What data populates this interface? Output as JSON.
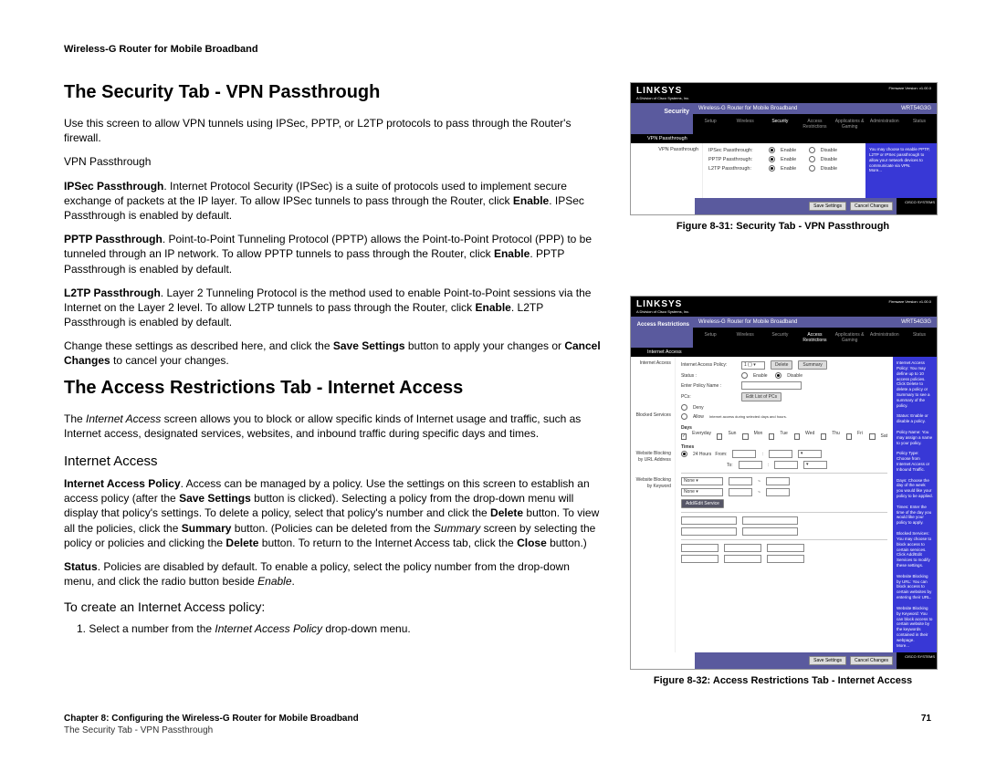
{
  "header": "Wireless-G Router for Mobile Broadband",
  "h1a": "The Security Tab - VPN Passthrough",
  "p1": "Use this screen to allow VPN tunnels using IPSec, PPTP, or L2TP protocols to pass through the Router's firewall.",
  "p2": "VPN Passthrough",
  "p3": "<b>IPSec Passthrough</b>. Internet Protocol Security (IPSec) is a suite of protocols used to implement secure exchange of packets at the IP layer. To allow IPSec tunnels to pass through the Router, click <b>Enable</b>. IPSec Passthrough is enabled by default.",
  "p4": "<b>PPTP Passthrough</b>. Point-to-Point Tunneling Protocol (PPTP) allows the Point-to-Point Protocol (PPP) to be tunneled through an IP network. To allow PPTP tunnels to pass through the Router, click <b>Enable</b>. PPTP Passthrough is enabled by default.",
  "p5": "<b>L2TP Passthrough</b>. Layer 2 Tunneling Protocol is the method used to enable Point-to-Point sessions via the Internet on the Layer 2 level. To allow L2TP tunnels to pass through the Router, click <b>Enable</b>. L2TP Passthrough is enabled by default.",
  "p6": "Change these settings as described here, and click the <b>Save Settings</b> button to apply your changes or <b>Cancel Changes</b> to cancel your changes.",
  "h1b": "The Access Restrictions Tab - Internet Access",
  "p7": "The <i>Internet Access</i> screen allows you to block or allow specific kinds of Internet usage and traffic, such as Internet access, designated services, websites, and inbound traffic during specific days and times.",
  "h2a": "Internet Access",
  "p8": "<b>Internet Access Policy</b>. Access can be managed by a policy. Use the settings on this screen to establish an access policy (after the <b>Save Settings</b> button is clicked). Selecting a policy from the drop-down menu will display that policy's settings. To delete a policy, select that policy's number and click the <b>Delete</b> button. To view all the policies, click the <b>Summary</b> button. (Policies can be deleted from the <i>Summary</i> screen by selecting the policy or policies and clicking the <b>Delete</b> button. To return to the Internet Access tab, click the <b>Close</b> button.)",
  "p9": "<b>Status</b>. Policies are disabled by default. To enable a policy, select the policy number from the drop-down menu, and click the radio button beside <i>Enable</i>.",
  "h3a": "To create an Internet Access policy:",
  "li1": "1.   Select a number from the <i>Internet Access Policy</i> drop-down menu.",
  "caption1": "Figure 8-31: Security Tab - VPN Passthrough",
  "caption2": "Figure 8-32: Access Restrictions Tab - Internet Access",
  "logo": "LINKSYS",
  "sublogo": "A Division of Cisco Systems, Inc.",
  "fw": "Firmware Version: v1.00.0",
  "product": "Wireless-G Router for Mobile Broadband",
  "model": "WRT54G3G",
  "nav": [
    "Setup",
    "Wireless",
    "Security",
    "Access Restrictions",
    "Applications & Gaming",
    "Administration",
    "Status"
  ],
  "sec_label": "Security",
  "subnav1": "VPN Passthrough",
  "vpn_rows": [
    {
      "label": "IPSec Passthrough:",
      "on": "Enable",
      "off": "Disable"
    },
    {
      "label": "PPTP Passthrough:",
      "on": "Enable",
      "off": "Disable"
    },
    {
      "label": "L2TP Passthrough:",
      "on": "Enable",
      "off": "Disable"
    }
  ],
  "help1": "You may choose to enable PPTP, L2TP or IPSec passthrough to allow your network devices to communicate via VPN.\nMore...",
  "save": "Save Settings",
  "cancel": "Cancel Changes",
  "cisco": "CISCO SYSTEMS",
  "ar_label": "Access Restrictions",
  "subnav2": "Internet Access",
  "iap": "Internet Access Policy:",
  "policy_sel": "1 ( )",
  "delete": "Delete",
  "summary": "Summary",
  "status": "Status :",
  "enable": "Enable",
  "disable": "Disable",
  "enter_policy": "Enter Policy Name :",
  "pcs": "PCs:",
  "edit_list": "Edit List of PCs",
  "deny": "Deny",
  "allow": "Allow",
  "days": "Days",
  "everyday": "Everyday",
  "dow": [
    "Sun",
    "Mon",
    "Tue",
    "Wed",
    "Thu",
    "Fri",
    "Sat"
  ],
  "times": "Times",
  "h24": "24 Hours",
  "from": "From:",
  "to": "To:",
  "blocked_services": "Blocked Services",
  "none": "None",
  "add_edit": "Add/Edit Service",
  "wb_url": "Website Blocking by URL Address",
  "wb_kw": "Website Blocking by Keyword",
  "help2": "Internet Access Policy: You may define up to 10 access policies. Click Delete to delete a policy or Summary to see a summary of the policy.\n\nStatus: Enable or disable a policy.\n\nPolicy Name: You may assign a name to your policy.\n\nPolicy Type: Choose from Internet Access or Inbound Traffic.\n\nDays: Choose the day of the week you would like your policy to be applied.\n\nTimes: Enter the time of the day you would like your policy to apply.\n\nBlocked Services: You may choose to block access to certain services. Click Add/Edit Services to modify these settings.\n\nWebsite Blocking by URL: You can block access to certain websites by entering their URL.\n\nWebsite Blocking by Keyword: You can block access to certain website by the keywords contained in their webpage.\nMore...",
  "footer_chapter": "Chapter 8: Configuring the Wireless-G Router for Mobile Broadband",
  "footer_section": "The Security Tab - VPN Passthrough",
  "page_num": "71"
}
